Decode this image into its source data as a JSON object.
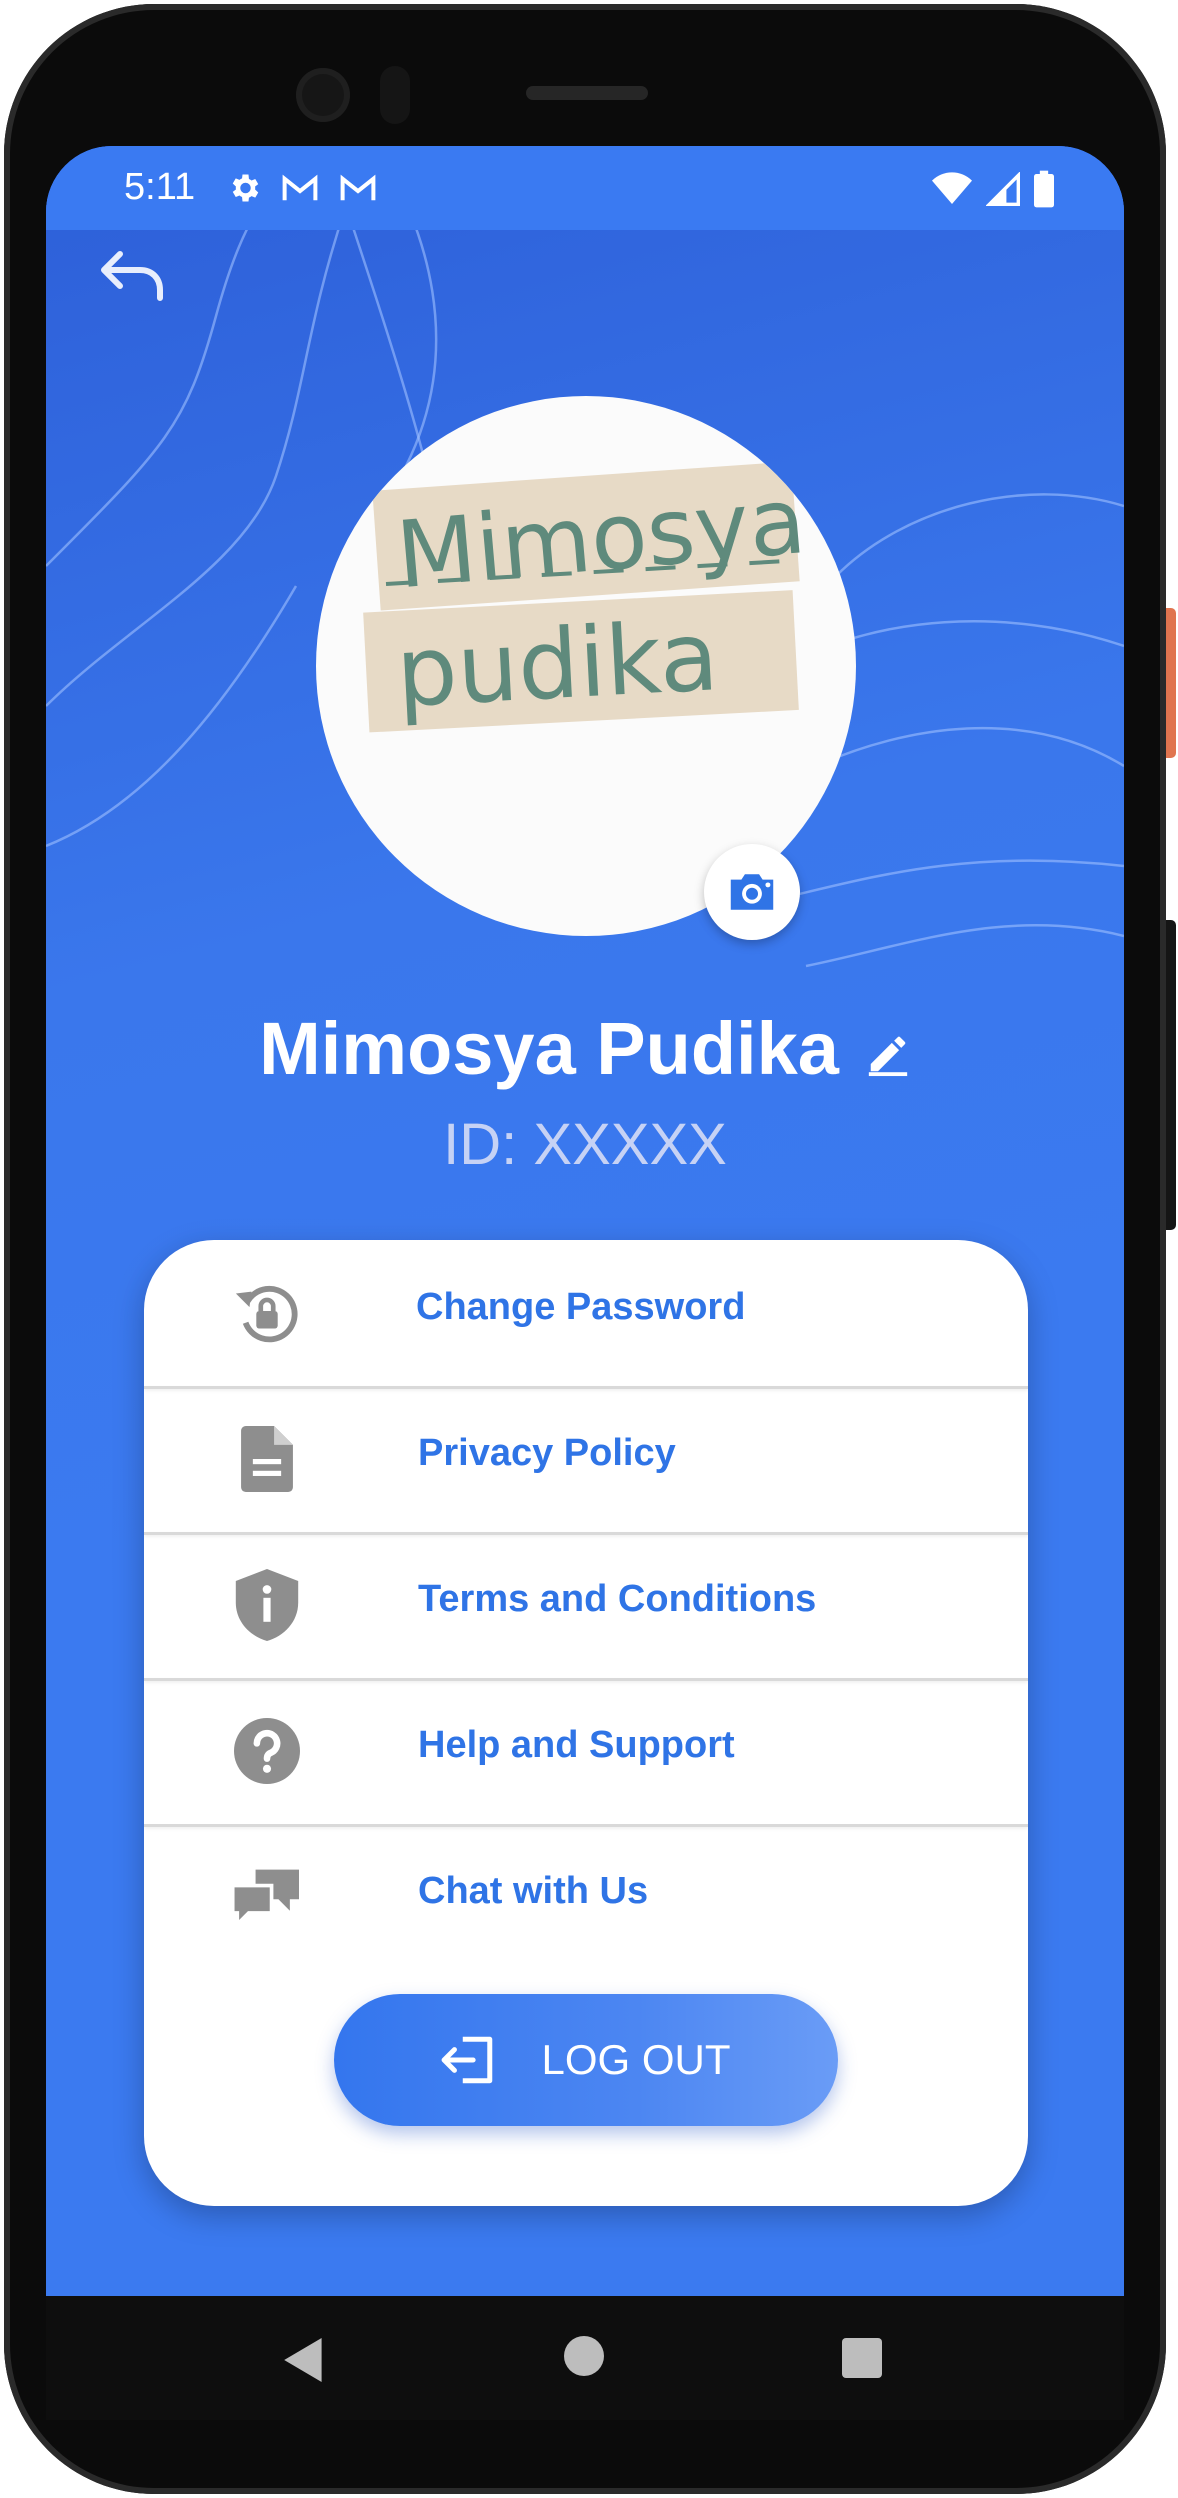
{
  "status_bar": {
    "time": "5:11",
    "left_icons": [
      "settings-icon",
      "gmail-icon",
      "gmail-icon"
    ],
    "right_icons": [
      "wifi-icon",
      "signal-icon",
      "battery-icon"
    ]
  },
  "header": {
    "back_icon": "back-arrow-icon"
  },
  "profile": {
    "avatar_text_line1": "Mimosya",
    "avatar_text_line2": "pudika",
    "name": "Mimosya Pudika",
    "id_text": "ID: XXXXX"
  },
  "menu": {
    "items": [
      {
        "label": "Change Password",
        "icon": "lock-reset-icon"
      },
      {
        "label": "Privacy Policy",
        "icon": "document-icon"
      },
      {
        "label": "Terms and Conditions",
        "icon": "shield-info-icon"
      },
      {
        "label": "Help and Support",
        "icon": "help-circle-icon"
      },
      {
        "label": "Chat with Us",
        "icon": "chat-bubbles-icon"
      }
    ],
    "logout_label": "LOG OUT"
  },
  "colors": {
    "primary": "#3b7af0",
    "accent_text": "#2f74e6",
    "icon_gray": "#9a9a9a"
  }
}
